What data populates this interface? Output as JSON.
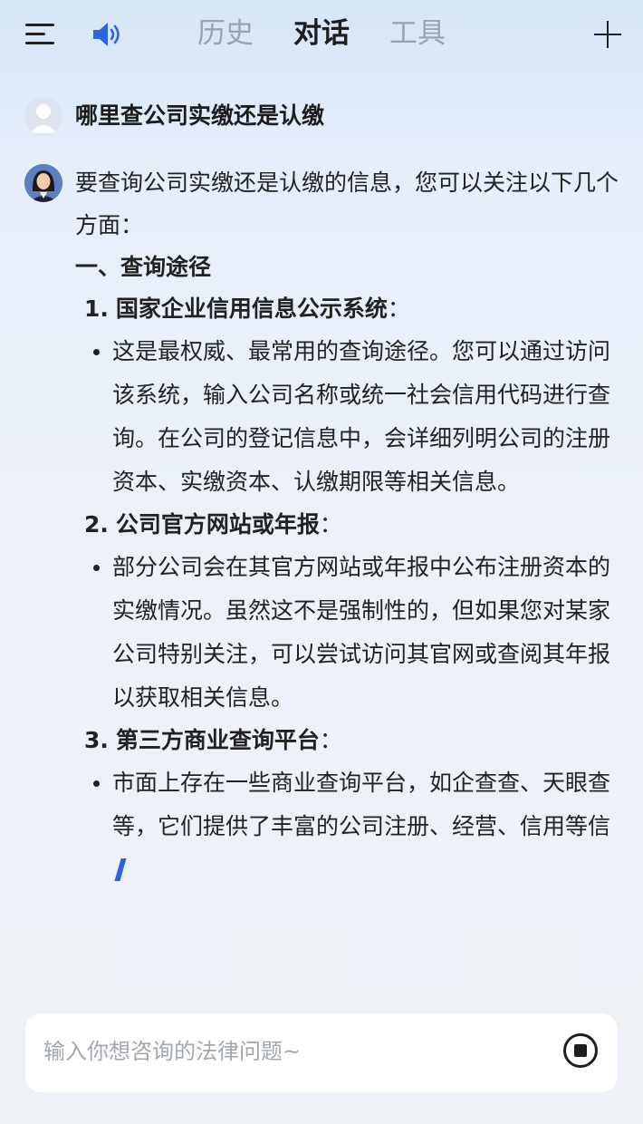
{
  "header": {
    "tabs": [
      {
        "label": "历史",
        "active": false
      },
      {
        "label": "对话",
        "active": true
      },
      {
        "label": "工具",
        "active": false
      }
    ],
    "icons": {
      "menu": "menu-icon",
      "speaker": "speaker-icon",
      "new_chat": "plus-icon"
    },
    "accent_color": "#2e63e0"
  },
  "chat": {
    "user_question": "哪里查公司实缴还是认缴",
    "answer": {
      "intro": "要查询公司实缴还是认缴的信息，您可以关注以下几个方面：",
      "section_title": "一、查询途径",
      "items": [
        {
          "number": "1.",
          "title": "国家企业信用信息公示系统",
          "colon": "：",
          "bullet": "这是最权威、最常用的查询途径。您可以通过访问该系统，输入公司名称或统一社会信用代码进行查询。在公司的登记信息中，会详细列明公司的注册资本、实缴资本、认缴期限等相关信息。"
        },
        {
          "number": "2.",
          "title": "公司官方网站或年报",
          "colon": "：",
          "bullet": "部分公司会在其官方网站或年报中公布注册资本的实缴情况。虽然这不是强制性的，但如果您对某家公司特别关注，可以尝试访问其官网或查阅其年报以获取相关信息。"
        },
        {
          "number": "3.",
          "title": "第三方商业查询平台",
          "colon": "：",
          "bullet": "市面上存在一些商业查询平台，如企查查、天眼查等，它们提供了丰富的公司注册、经营、信用等信"
        }
      ],
      "streaming": true
    }
  },
  "composer": {
    "placeholder": "输入你想咨询的法律问题~",
    "value": "",
    "stop_icon": "stop-circle-icon"
  }
}
